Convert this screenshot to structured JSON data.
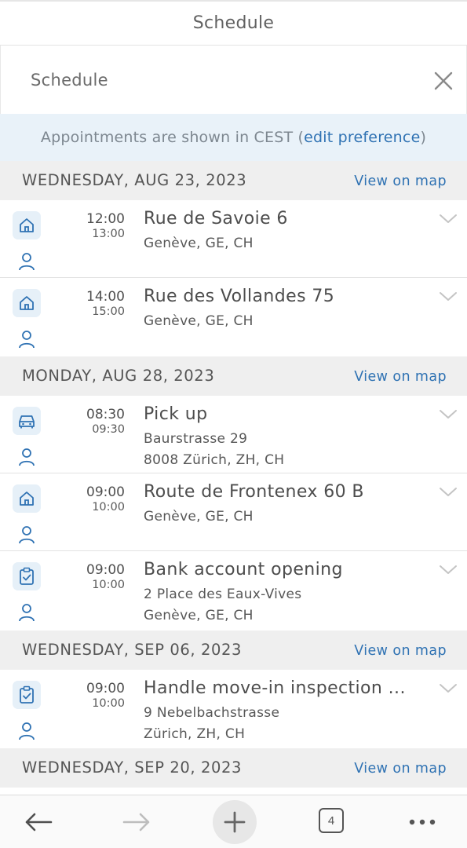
{
  "browser": {
    "title": "Schedule"
  },
  "panel": {
    "title": "Schedule"
  },
  "timezone": {
    "prefix": "Appointments are shown in CEST (",
    "link": "edit preference",
    "suffix": ")"
  },
  "days": [
    {
      "label": "WEDNESDAY, AUG 23, 2023",
      "map_link": "View on map",
      "appointments": [
        {
          "icon": "home-icon",
          "start": "12:00",
          "end": "13:00",
          "title": "Rue de Savoie 6",
          "line1": "Genève, GE, CH",
          "line2": ""
        },
        {
          "icon": "home-icon",
          "start": "14:00",
          "end": "15:00",
          "title": "Rue des Vollandes 75",
          "line1": "Genève, GE, CH",
          "line2": ""
        }
      ]
    },
    {
      "label": "MONDAY, AUG 28, 2023",
      "map_link": "View on map",
      "appointments": [
        {
          "icon": "car-icon",
          "start": "08:30",
          "end": "09:30",
          "title": "Pick up",
          "line1": "Baurstrasse 29",
          "line2": "8008 Zürich, ZH, CH"
        },
        {
          "icon": "home-icon",
          "start": "09:00",
          "end": "10:00",
          "title": "Route de Frontenex 60 B",
          "line1": "Genève, GE, CH",
          "line2": ""
        },
        {
          "icon": "clipboard-check-icon",
          "start": "09:00",
          "end": "10:00",
          "title": "Bank account opening",
          "line1": "2 Place des Eaux-Vives",
          "line2": "Genève, GE, CH"
        }
      ]
    },
    {
      "label": "WEDNESDAY, SEP 06, 2023",
      "map_link": "View on map",
      "appointments": [
        {
          "icon": "clipboard-check-icon",
          "start": "09:00",
          "end": "10:00",
          "title": "Handle move-in inspection ...",
          "line1": "9 Nebelbachstrasse",
          "line2": "Zürich, ZH, CH"
        }
      ]
    },
    {
      "label": "WEDNESDAY, SEP 20, 2023",
      "map_link": "View on map",
      "appointments": []
    }
  ],
  "toolbar": {
    "back_icon": "arrow-left-icon",
    "forward_icon": "arrow-right-icon",
    "new_tab_icon": "plus-icon",
    "tab_count": "4",
    "menu_icon": "more-dots-icon"
  },
  "colors": {
    "accent": "#2f72b3",
    "info_bar": "#e9f2f9",
    "day_header": "#efefef",
    "icon_badge": "#e6f0f8",
    "icon_stroke": "#2f72b3"
  }
}
